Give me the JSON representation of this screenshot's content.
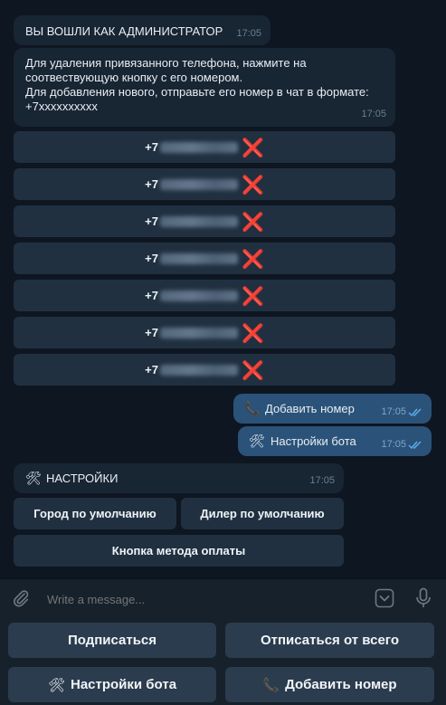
{
  "admin_msg": {
    "text": "ВЫ ВОШЛИ КАК АДМИНИСТРАТОР",
    "time": "17:05"
  },
  "info_msg": {
    "line1": "Для удаления привязанного телефона, нажмите на",
    "line2": "соотвествующую кнопку с его номером.",
    "line3": "Для добавления нового, отправьте его номер в чат в формате:",
    "line4": "+7xxxxxxxxxx",
    "time": "17:05"
  },
  "phones": [
    {
      "prefix": "+7",
      "delete": "❌"
    },
    {
      "prefix": "+7",
      "delete": "❌"
    },
    {
      "prefix": "+7",
      "delete": "❌"
    },
    {
      "prefix": "+7",
      "delete": "❌"
    },
    {
      "prefix": "+7",
      "delete": "❌"
    },
    {
      "prefix": "+7",
      "delete": "❌"
    },
    {
      "prefix": "+7",
      "delete": "❌"
    }
  ],
  "sent": [
    {
      "emoji": "📞",
      "text": "Добавить номер",
      "time": "17:05"
    },
    {
      "emoji": "🛠",
      "text": "Настройки бота",
      "time": "17:05"
    }
  ],
  "settings_msg": {
    "emoji": "🛠",
    "text": "НАСТРОЙКИ",
    "time": "17:05"
  },
  "settings_buttons": {
    "city": "Город по умолчанию",
    "dealer": "Дилер по умолчанию",
    "payment": "Кнопка метода оплаты"
  },
  "composer": {
    "placeholder": "Write a message..."
  },
  "reply_keyboard": {
    "subscribe": "Подписаться",
    "unsubscribe": "Отписаться от всего",
    "bot_settings_emoji": "🛠",
    "bot_settings": "Настройки бота",
    "add_number_emoji": "📞",
    "add_number": "Добавить номер"
  },
  "colors": {
    "background": "#0e1621",
    "incoming_bubble": "#182533",
    "outgoing_bubble": "#2b5278",
    "inline_button": "#203040",
    "delete_icon": "#e3243b",
    "read_ticks": "#5fb0ee"
  }
}
